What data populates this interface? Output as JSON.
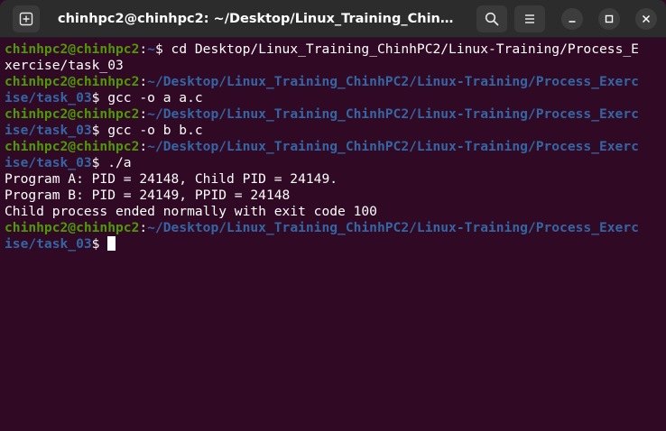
{
  "window": {
    "title": "chinhpc2@chinhpc2: ~/Desktop/Linux_Training_ChinhPC2/Linux-Training/Process_Exercise/task_03"
  },
  "icons": {
    "new_tab": "new-tab-icon",
    "search": "search-icon",
    "menu": "hamburger-menu-icon",
    "minimize": "minimize-icon",
    "maximize": "maximize-icon",
    "close": "close-icon"
  },
  "colors": {
    "background": "#300a24",
    "prompt_user": "#4e9a06",
    "prompt_path": "#3465a4",
    "text": "#ffffff"
  },
  "terminal": {
    "lines": [
      {
        "user": "chinhpc2@chinhpc2",
        "sep": ":",
        "path": "~",
        "rest": "$ cd Desktop/Linux_Training_ChinhPC2/Linux-Training/Process_E"
      },
      {
        "text": "xercise/task_03"
      },
      {
        "user": "chinhpc2@chinhpc2",
        "sep": ":",
        "path": "~/Desktop/Linux_Training_ChinhPC2/Linux-Training/Process_Exerc"
      },
      {
        "path": "ise/task_03",
        "rest": "$ gcc -o a a.c"
      },
      {
        "user": "chinhpc2@chinhpc2",
        "sep": ":",
        "path": "~/Desktop/Linux_Training_ChinhPC2/Linux-Training/Process_Exerc"
      },
      {
        "path": "ise/task_03",
        "rest": "$ gcc -o b b.c"
      },
      {
        "user": "chinhpc2@chinhpc2",
        "sep": ":",
        "path": "~/Desktop/Linux_Training_ChinhPC2/Linux-Training/Process_Exerc"
      },
      {
        "path": "ise/task_03",
        "rest": "$ ./a"
      },
      {
        "text": "Program A: PID = 24148, Child PID = 24149."
      },
      {
        "text": "Program B: PID = 24149, PPID = 24148"
      },
      {
        "text": "Child process ended normally with exit code 100"
      },
      {
        "user": "chinhpc2@chinhpc2",
        "sep": ":",
        "path": "~/Desktop/Linux_Training_ChinhPC2/Linux-Training/Process_Exerc"
      },
      {
        "path": "ise/task_03",
        "rest": "$ "
      }
    ]
  }
}
